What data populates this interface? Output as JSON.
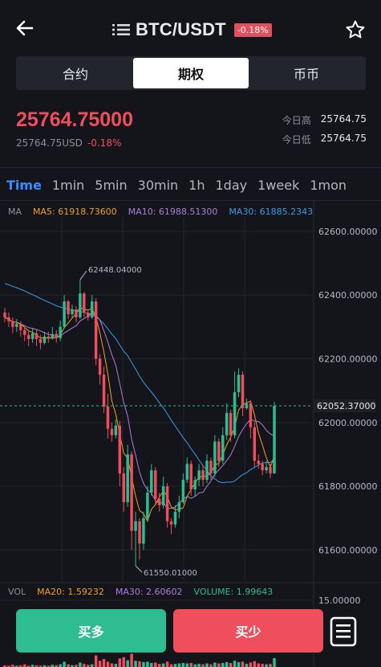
{
  "header": {
    "pair": "BTC/USDT",
    "change_badge": "-0.18%"
  },
  "tabs": [
    {
      "label": "合约",
      "active": false
    },
    {
      "label": "期权",
      "active": true
    },
    {
      "label": "币币",
      "active": false
    }
  ],
  "price": {
    "last": "25764.75000",
    "usd": "25764.75USD",
    "change": "-0.18%",
    "high_label": "今日高",
    "high_value": "25764.75",
    "low_label": "今日低",
    "low_value": "25764.75"
  },
  "intervals": [
    "Time",
    "1min",
    "5min",
    "30min",
    "1h",
    "1day",
    "1week",
    "1mon"
  ],
  "active_interval": "Time",
  "ma_legend": [
    {
      "text": "MA",
      "color": "#8c909a"
    },
    {
      "text": "MA5: 61918.73600",
      "color": "#f0a11e"
    },
    {
      "text": "MA10: 61988.51300",
      "color": "#b07be0"
    },
    {
      "text": "MA30: 61885.2343",
      "color": "#3a9bea"
    }
  ],
  "vol_legend": [
    {
      "text": "VOL",
      "color": "#8c909a"
    },
    {
      "text": "MA20: 1.59232",
      "color": "#f0a11e"
    },
    {
      "text": "MA30: 2.60602",
      "color": "#b07be0"
    },
    {
      "text": "VOLUME: 1.99643",
      "color": "#2ebd91"
    }
  ],
  "chart_data": {
    "type": "candlestick",
    "y_ticks": [
      "62600.00000",
      "62400.00000",
      "62200.00000",
      "62000.00000",
      "61800.00000",
      "61600.00000"
    ],
    "ylim": [
      61510,
      62620
    ],
    "current_price_label": "62052.37000",
    "current_price": 62052.37,
    "max_label": "62448.04000",
    "min_label": "61550.01000",
    "max_value": 62448.04,
    "min_value": 61550.01,
    "vol_tick": "15.00000",
    "colors": {
      "up": "#2ebd91",
      "down": "#ef4e5c",
      "ma5": "#f0a11e",
      "ma10": "#b07be0",
      "ma30": "#3a9bea",
      "current": "#2ebd91"
    },
    "candles": [
      [
        62345,
        62330,
        62360,
        62315
      ],
      [
        62330,
        62318,
        62345,
        62300
      ],
      [
        62318,
        62300,
        62330,
        62280
      ],
      [
        62300,
        62310,
        62325,
        62285
      ],
      [
        62310,
        62290,
        62318,
        62270
      ],
      [
        62290,
        62275,
        62300,
        62255
      ],
      [
        62275,
        62262,
        62285,
        62240
      ],
      [
        62262,
        62280,
        62295,
        62250
      ],
      [
        62280,
        62262,
        62290,
        62240
      ],
      [
        62262,
        62250,
        62275,
        62230
      ],
      [
        62250,
        62270,
        62285,
        62245
      ],
      [
        62270,
        62265,
        62285,
        62250
      ],
      [
        62265,
        62278,
        62300,
        62260
      ],
      [
        62278,
        62265,
        62290,
        62250
      ],
      [
        62265,
        62300,
        62320,
        62255
      ],
      [
        62300,
        62380,
        62400,
        62295
      ],
      [
        62380,
        62340,
        62385,
        62325
      ],
      [
        62340,
        62355,
        62370,
        62330
      ],
      [
        62355,
        62330,
        62365,
        62315
      ],
      [
        62330,
        62405,
        62448,
        62325
      ],
      [
        62405,
        62345,
        62410,
        62330
      ],
      [
        62345,
        62330,
        62355,
        62320
      ],
      [
        62330,
        62380,
        62400,
        62325
      ],
      [
        62380,
        62200,
        62390,
        62180
      ],
      [
        62200,
        62150,
        62215,
        62120
      ],
      [
        62150,
        62050,
        62175,
        62030
      ],
      [
        62050,
        61980,
        62090,
        61950
      ],
      [
        61980,
        61960,
        62000,
        61940
      ],
      [
        61960,
        61990,
        62010,
        61950
      ],
      [
        61990,
        61840,
        62005,
        61800
      ],
      [
        61840,
        61750,
        61860,
        61720
      ],
      [
        61750,
        61900,
        61930,
        61735
      ],
      [
        61900,
        61660,
        61910,
        61600
      ],
      [
        61660,
        61690,
        61720,
        61550
      ],
      [
        61690,
        61620,
        61700,
        61570
      ],
      [
        61620,
        61700,
        61720,
        61600
      ],
      [
        61700,
        61780,
        61800,
        61690
      ],
      [
        61780,
        61850,
        61870,
        61770
      ],
      [
        61850,
        61760,
        61860,
        61745
      ],
      [
        61760,
        61740,
        61780,
        61720
      ],
      [
        61740,
        61800,
        61830,
        61730
      ],
      [
        61800,
        61690,
        61810,
        61670
      ],
      [
        61690,
        61680,
        61700,
        61650
      ],
      [
        61680,
        61720,
        61740,
        61670
      ],
      [
        61720,
        61750,
        61770,
        61700
      ],
      [
        61750,
        61820,
        61840,
        61745
      ],
      [
        61820,
        61870,
        61890,
        61810
      ],
      [
        61870,
        61790,
        61880,
        61770
      ],
      [
        61790,
        61820,
        61830,
        61770
      ],
      [
        61820,
        61850,
        61870,
        61800
      ],
      [
        61850,
        61820,
        61865,
        61800
      ],
      [
        61820,
        61880,
        61900,
        61810
      ],
      [
        61880,
        61840,
        61890,
        61820
      ],
      [
        61840,
        61940,
        61960,
        61830
      ],
      [
        61940,
        61880,
        61950,
        61860
      ],
      [
        61880,
        61960,
        61985,
        61870
      ],
      [
        61960,
        62030,
        62060,
        61945
      ],
      [
        62030,
        61960,
        62040,
        61940
      ],
      [
        61960,
        62095,
        62160,
        61950
      ],
      [
        62095,
        62150,
        62170,
        62080
      ],
      [
        62150,
        62045,
        62160,
        62020
      ],
      [
        62045,
        62060,
        62075,
        62040
      ],
      [
        62060,
        61985,
        62070,
        61950
      ],
      [
        61985,
        61880,
        62000,
        61860
      ],
      [
        61880,
        61870,
        61900,
        61855
      ],
      [
        61870,
        61850,
        61880,
        61835
      ],
      [
        61850,
        61860,
        61880,
        61840
      ],
      [
        61860,
        61840,
        61870,
        61825
      ],
      [
        61840,
        62052,
        62065,
        61840
      ]
    ],
    "volumes": [
      0.4,
      0.3,
      0.5,
      0.3,
      0.4,
      0.6,
      0.3,
      0.5,
      0.4,
      0.3,
      0.4,
      0.3,
      0.5,
      0.4,
      0.6,
      1.2,
      0.6,
      0.4,
      0.5,
      1.0,
      0.7,
      0.5,
      0.6,
      2.6,
      1.4,
      1.8,
      1.2,
      0.8,
      0.7,
      1.9,
      2.2,
      1.5,
      3.0,
      1.4,
      1.3,
      1.1,
      1.2,
      0.9,
      1.0,
      0.7,
      0.8,
      1.2,
      0.6,
      0.7,
      0.8,
      0.9,
      0.8,
      0.9,
      0.6,
      0.7,
      0.6,
      0.8,
      0.6,
      1.0,
      0.8,
      0.9,
      1.1,
      0.9,
      1.4,
      1.1,
      1.2,
      0.7,
      1.0,
      1.3,
      0.8,
      0.7,
      0.6,
      0.7,
      2.0
    ]
  },
  "actions": {
    "long_label": "买多",
    "short_label": "买少"
  }
}
